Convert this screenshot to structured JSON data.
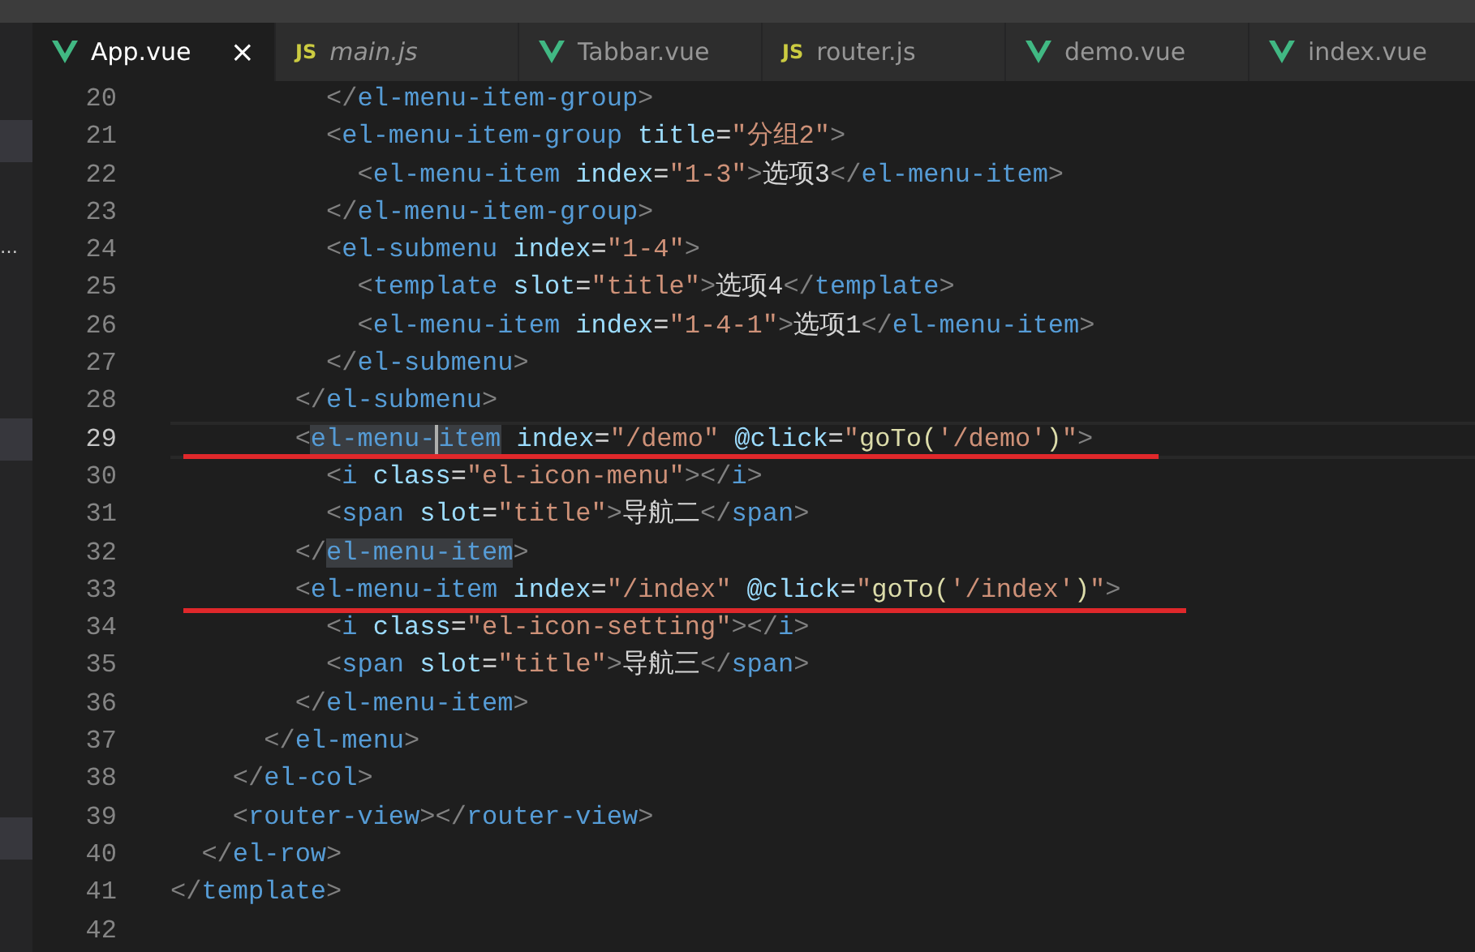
{
  "tabs": [
    {
      "kind": "vue",
      "label": "App.vue",
      "selected": true,
      "preview": false,
      "close": "×"
    },
    {
      "kind": "js",
      "icon_text": "JS",
      "label": "main.js",
      "selected": false,
      "preview": true
    },
    {
      "kind": "vue",
      "label": "Tabbar.vue",
      "selected": false,
      "preview": false
    },
    {
      "kind": "js",
      "icon_text": "JS",
      "label": "router.js",
      "selected": false,
      "preview": false
    },
    {
      "kind": "vue",
      "label": "demo.vue",
      "selected": false,
      "preview": false
    },
    {
      "kind": "vue",
      "label": "index.vue",
      "selected": false,
      "preview": false
    }
  ],
  "sidebar": {
    "rows": [
      {
        "selected": true
      },
      {
        "text": "…",
        "selected": false
      },
      {
        "selected": true
      },
      {
        "selected": true
      }
    ]
  },
  "editor": {
    "lines": [
      {
        "number": "20",
        "current": false,
        "underlined": false,
        "tokens": [
          {
            "kind": "punct",
            "text": "          </"
          },
          {
            "kind": "tag",
            "text": "el-menu-item-group"
          },
          {
            "kind": "punct",
            "text": ">"
          }
        ]
      },
      {
        "number": "21",
        "current": false,
        "underlined": false,
        "tokens": [
          {
            "kind": "punct",
            "text": "          <"
          },
          {
            "kind": "tag",
            "text": "el-menu-item-group"
          },
          {
            "kind": "attr",
            "text": " title"
          },
          {
            "kind": "equals",
            "text": "="
          },
          {
            "kind": "string",
            "text": "\"分组2\""
          },
          {
            "kind": "punct",
            "text": ">"
          }
        ]
      },
      {
        "number": "22",
        "current": false,
        "underlined": false,
        "tokens": [
          {
            "kind": "punct",
            "text": "            <"
          },
          {
            "kind": "tag",
            "text": "el-menu-item"
          },
          {
            "kind": "attr",
            "text": " index"
          },
          {
            "kind": "equals",
            "text": "="
          },
          {
            "kind": "string",
            "text": "\"1-3\""
          },
          {
            "kind": "punct",
            "text": ">"
          },
          {
            "kind": "text",
            "text": "选项3"
          },
          {
            "kind": "punct",
            "text": "</"
          },
          {
            "kind": "tag",
            "text": "el-menu-item"
          },
          {
            "kind": "punct",
            "text": ">"
          }
        ]
      },
      {
        "number": "23",
        "current": false,
        "underlined": false,
        "tokens": [
          {
            "kind": "punct",
            "text": "          </"
          },
          {
            "kind": "tag",
            "text": "el-menu-item-group"
          },
          {
            "kind": "punct",
            "text": ">"
          }
        ]
      },
      {
        "number": "24",
        "current": false,
        "underlined": false,
        "tokens": [
          {
            "kind": "punct",
            "text": "          <"
          },
          {
            "kind": "tag",
            "text": "el-submenu"
          },
          {
            "kind": "attr",
            "text": " index"
          },
          {
            "kind": "equals",
            "text": "="
          },
          {
            "kind": "string",
            "text": "\"1-4\""
          },
          {
            "kind": "punct",
            "text": ">"
          }
        ]
      },
      {
        "number": "25",
        "current": false,
        "underlined": false,
        "tokens": [
          {
            "kind": "punct",
            "text": "            <"
          },
          {
            "kind": "tag",
            "text": "template"
          },
          {
            "kind": "attr",
            "text": " slot"
          },
          {
            "kind": "equals",
            "text": "="
          },
          {
            "kind": "string",
            "text": "\"title\""
          },
          {
            "kind": "punct",
            "text": ">"
          },
          {
            "kind": "text",
            "text": "选项4"
          },
          {
            "kind": "punct",
            "text": "</"
          },
          {
            "kind": "tag",
            "text": "template"
          },
          {
            "kind": "punct",
            "text": ">"
          }
        ]
      },
      {
        "number": "26",
        "current": false,
        "underlined": false,
        "tokens": [
          {
            "kind": "punct",
            "text": "            <"
          },
          {
            "kind": "tag",
            "text": "el-menu-item"
          },
          {
            "kind": "attr",
            "text": " index"
          },
          {
            "kind": "equals",
            "text": "="
          },
          {
            "kind": "string",
            "text": "\"1-4-1\""
          },
          {
            "kind": "punct",
            "text": ">"
          },
          {
            "kind": "text",
            "text": "选项1"
          },
          {
            "kind": "punct",
            "text": "</"
          },
          {
            "kind": "tag",
            "text": "el-menu-item"
          },
          {
            "kind": "punct",
            "text": ">"
          }
        ]
      },
      {
        "number": "27",
        "current": false,
        "underlined": false,
        "tokens": [
          {
            "kind": "punct",
            "text": "          </"
          },
          {
            "kind": "tag",
            "text": "el-submenu"
          },
          {
            "kind": "punct",
            "text": ">"
          }
        ]
      },
      {
        "number": "28",
        "current": false,
        "underlined": false,
        "tokens": [
          {
            "kind": "punct",
            "text": "        </"
          },
          {
            "kind": "tag",
            "text": "el-submenu"
          },
          {
            "kind": "punct",
            "text": ">"
          }
        ]
      },
      {
        "number": "29",
        "current": true,
        "underlined": true,
        "tokens": [
          {
            "kind": "punct",
            "text": "        <"
          },
          {
            "kind": "match",
            "text": "el-menu-"
          },
          {
            "kind": "caret"
          },
          {
            "kind": "match",
            "text": "item"
          },
          {
            "kind": "attr",
            "text": " index"
          },
          {
            "kind": "equals",
            "text": "="
          },
          {
            "kind": "string",
            "text": "\"/demo\""
          },
          {
            "kind": "attr",
            "text": " @click"
          },
          {
            "kind": "equals",
            "text": "="
          },
          {
            "kind": "string",
            "text": "\""
          },
          {
            "kind": "call",
            "text": "goTo("
          },
          {
            "kind": "string",
            "text": "'/demo'"
          },
          {
            "kind": "call",
            "text": ")"
          },
          {
            "kind": "string",
            "text": "\""
          },
          {
            "kind": "punct",
            "text": ">"
          }
        ]
      },
      {
        "number": "30",
        "current": false,
        "underlined": false,
        "tokens": [
          {
            "kind": "punct",
            "text": "          <"
          },
          {
            "kind": "tag",
            "text": "i"
          },
          {
            "kind": "attr",
            "text": " class"
          },
          {
            "kind": "equals",
            "text": "="
          },
          {
            "kind": "string",
            "text": "\"el-icon-menu\""
          },
          {
            "kind": "punct",
            "text": "></"
          },
          {
            "kind": "tag",
            "text": "i"
          },
          {
            "kind": "punct",
            "text": ">"
          }
        ]
      },
      {
        "number": "31",
        "current": false,
        "underlined": false,
        "tokens": [
          {
            "kind": "punct",
            "text": "          <"
          },
          {
            "kind": "tag",
            "text": "span"
          },
          {
            "kind": "attr",
            "text": " slot"
          },
          {
            "kind": "equals",
            "text": "="
          },
          {
            "kind": "string",
            "text": "\"title\""
          },
          {
            "kind": "punct",
            "text": ">"
          },
          {
            "kind": "text",
            "text": "导航二"
          },
          {
            "kind": "punct",
            "text": "</"
          },
          {
            "kind": "tag",
            "text": "span"
          },
          {
            "kind": "punct",
            "text": ">"
          }
        ]
      },
      {
        "number": "32",
        "current": false,
        "underlined": false,
        "tokens": [
          {
            "kind": "punct",
            "text": "        </"
          },
          {
            "kind": "match",
            "text": "el-menu-item"
          },
          {
            "kind": "punct",
            "text": ">"
          }
        ]
      },
      {
        "number": "33",
        "current": false,
        "underlined": true,
        "tokens": [
          {
            "kind": "punct",
            "text": "        <"
          },
          {
            "kind": "tag",
            "text": "el-menu-item"
          },
          {
            "kind": "attr",
            "text": " index"
          },
          {
            "kind": "equals",
            "text": "="
          },
          {
            "kind": "string",
            "text": "\"/index\""
          },
          {
            "kind": "attr",
            "text": " @click"
          },
          {
            "kind": "equals",
            "text": "="
          },
          {
            "kind": "string",
            "text": "\""
          },
          {
            "kind": "call",
            "text": "goTo("
          },
          {
            "kind": "string",
            "text": "'/index'"
          },
          {
            "kind": "call",
            "text": ")"
          },
          {
            "kind": "string",
            "text": "\""
          },
          {
            "kind": "punct",
            "text": ">"
          }
        ]
      },
      {
        "number": "34",
        "current": false,
        "underlined": false,
        "tokens": [
          {
            "kind": "punct",
            "text": "          <"
          },
          {
            "kind": "tag",
            "text": "i"
          },
          {
            "kind": "attr",
            "text": " class"
          },
          {
            "kind": "equals",
            "text": "="
          },
          {
            "kind": "string",
            "text": "\"el-icon-setting\""
          },
          {
            "kind": "punct",
            "text": "></"
          },
          {
            "kind": "tag",
            "text": "i"
          },
          {
            "kind": "punct",
            "text": ">"
          }
        ]
      },
      {
        "number": "35",
        "current": false,
        "underlined": false,
        "tokens": [
          {
            "kind": "punct",
            "text": "          <"
          },
          {
            "kind": "tag",
            "text": "span"
          },
          {
            "kind": "attr",
            "text": " slot"
          },
          {
            "kind": "equals",
            "text": "="
          },
          {
            "kind": "string",
            "text": "\"title\""
          },
          {
            "kind": "punct",
            "text": ">"
          },
          {
            "kind": "text",
            "text": "导航三"
          },
          {
            "kind": "punct",
            "text": "</"
          },
          {
            "kind": "tag",
            "text": "span"
          },
          {
            "kind": "punct",
            "text": ">"
          }
        ]
      },
      {
        "number": "36",
        "current": false,
        "underlined": false,
        "tokens": [
          {
            "kind": "punct",
            "text": "        </"
          },
          {
            "kind": "tag",
            "text": "el-menu-item"
          },
          {
            "kind": "punct",
            "text": ">"
          }
        ]
      },
      {
        "number": "37",
        "current": false,
        "underlined": false,
        "tokens": [
          {
            "kind": "punct",
            "text": "      </"
          },
          {
            "kind": "tag",
            "text": "el-menu"
          },
          {
            "kind": "punct",
            "text": ">"
          }
        ]
      },
      {
        "number": "38",
        "current": false,
        "underlined": false,
        "tokens": [
          {
            "kind": "punct",
            "text": "    </"
          },
          {
            "kind": "tag",
            "text": "el-col"
          },
          {
            "kind": "punct",
            "text": ">"
          }
        ]
      },
      {
        "number": "39",
        "current": false,
        "underlined": false,
        "tokens": [
          {
            "kind": "punct",
            "text": "    <"
          },
          {
            "kind": "tag",
            "text": "router-view"
          },
          {
            "kind": "punct",
            "text": "></"
          },
          {
            "kind": "tag",
            "text": "router-view"
          },
          {
            "kind": "punct",
            "text": ">"
          }
        ]
      },
      {
        "number": "40",
        "current": false,
        "underlined": false,
        "tokens": [
          {
            "kind": "punct",
            "text": "  </"
          },
          {
            "kind": "tag",
            "text": "el-row"
          },
          {
            "kind": "punct",
            "text": ">"
          }
        ]
      },
      {
        "number": "41",
        "current": false,
        "underlined": false,
        "tokens": [
          {
            "kind": "punct",
            "text": "</"
          },
          {
            "kind": "tag",
            "text": "template"
          },
          {
            "kind": "punct",
            "text": ">"
          }
        ]
      },
      {
        "number": "42",
        "current": false,
        "underlined": false
      }
    ]
  }
}
